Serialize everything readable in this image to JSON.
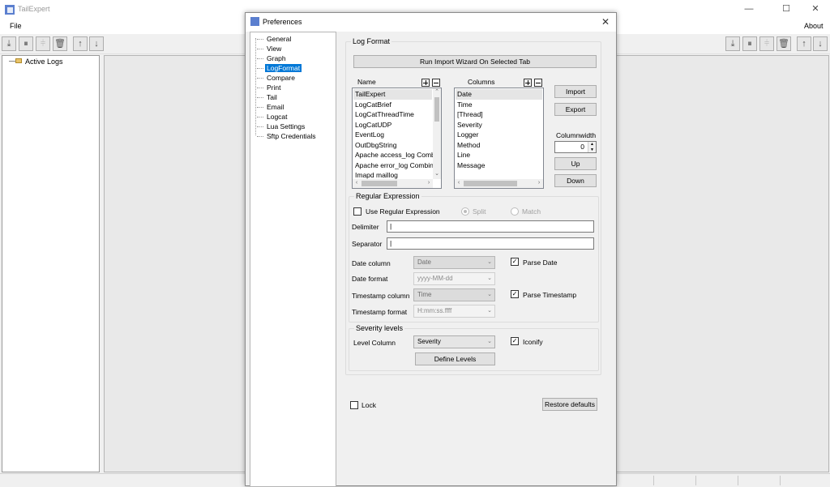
{
  "app": {
    "title": "TailExpert",
    "menu": {
      "file": "File",
      "about": "About"
    },
    "tree": {
      "root_label": "Active Logs"
    },
    "window_controls": {
      "minimize": "—",
      "maximize": "☐",
      "close": "✕"
    }
  },
  "dialog": {
    "title": "Preferences",
    "close_glyph": "✕",
    "nav": [
      {
        "label": "General"
      },
      {
        "label": "View"
      },
      {
        "label": "Graph"
      },
      {
        "label": "LogFormat"
      },
      {
        "label": "Compare"
      },
      {
        "label": "Print"
      },
      {
        "label": "Tail"
      },
      {
        "label": "Email"
      },
      {
        "label": "Logcat"
      },
      {
        "label": "Lua Settings"
      },
      {
        "label": "Sftp Credentials"
      }
    ],
    "selected_nav": "LogFormat",
    "log_format": {
      "group_label": "Log Format",
      "wizard_button": "Run Import Wizard On Selected Tab",
      "name_header": "Name",
      "columns_header": "Columns",
      "names": [
        "TailExpert",
        "LogCatBrief",
        "LogCatThreadTime",
        "LogCatUDP",
        "EventLog",
        "OutDbgString",
        "Apache access_log Comb",
        "Apache error_log Combine",
        "Imapd maillog"
      ],
      "selected_name": "TailExpert",
      "columns": [
        "Date",
        "Time",
        "[Thread]",
        "Severity",
        "Logger",
        "Method",
        "Line",
        "Message"
      ],
      "selected_column": "Date",
      "import_button": "Import",
      "export_button": "Export",
      "columnwidth_label": "Columnwidth",
      "columnwidth_value": "0",
      "up_button": "Up",
      "down_button": "Down"
    },
    "regex": {
      "group_label": "Regular Expression",
      "use_regex_label": "Use Regular Expression",
      "use_regex_checked": false,
      "split_label": "Split",
      "match_label": "Match",
      "delimiter_label": "Delimiter",
      "delimiter_value": "|",
      "separator_label": "Separator",
      "separator_value": "|",
      "date_column_label": "Date column",
      "date_column_value": "Date",
      "parse_date_label": "Parse Date",
      "date_format_label": "Date format",
      "date_format_value": "yyyy-MM-dd",
      "timestamp_column_label": "Timestamp column",
      "timestamp_column_value": "Time",
      "parse_timestamp_label": "Parse Timestamp",
      "timestamp_format_label": "Timestamp format",
      "timestamp_format_value": "H:mm:ss.ffff"
    },
    "severity": {
      "group_label": "Severity levels",
      "level_column_label": "Level Column",
      "level_column_value": "Severity",
      "iconify_label": "Iconify",
      "define_levels_button": "Define Levels"
    },
    "lock_label": "Lock",
    "restore_defaults_button": "Restore defaults"
  },
  "icons": {
    "check": "✓",
    "dropdown": "⌄",
    "up": "⌃",
    "down": "⌄",
    "left": "‹",
    "right": "›"
  },
  "colors": {
    "selection": "#0078d7",
    "app_icon": "#5b7fcf"
  }
}
